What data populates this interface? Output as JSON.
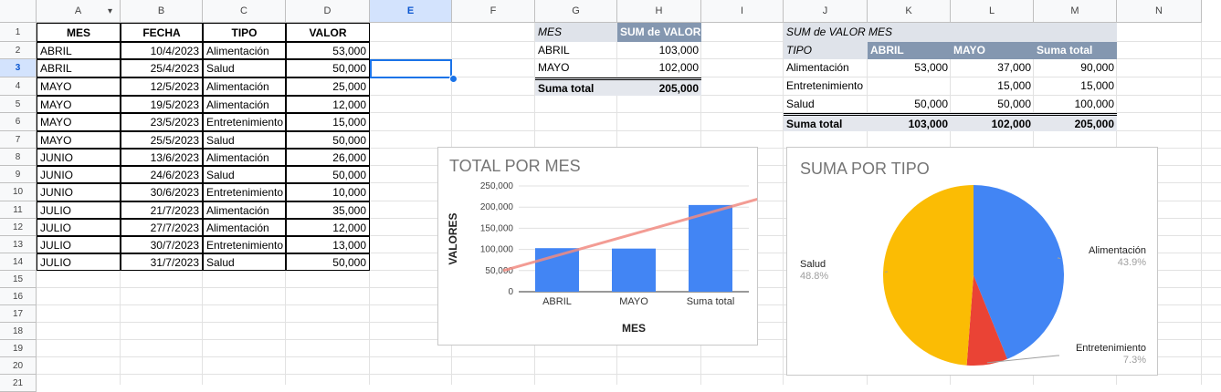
{
  "columns": [
    "A",
    "B",
    "C",
    "D",
    "E",
    "F",
    "G",
    "H",
    "I",
    "J",
    "K",
    "L",
    "M",
    "N"
  ],
  "rows": [
    "1",
    "2",
    "3",
    "4",
    "5",
    "6",
    "7",
    "8",
    "9",
    "10",
    "11",
    "12",
    "13",
    "14",
    "15",
    "16",
    "17",
    "18",
    "19",
    "20",
    "21"
  ],
  "table": {
    "headers": [
      "MES",
      "FECHA",
      "TIPO",
      "VALOR"
    ],
    "rows": [
      [
        "ABRIL",
        "10/4/2023",
        "Alimentación",
        "53,000"
      ],
      [
        "ABRIL",
        "25/4/2023",
        "Salud",
        "50,000"
      ],
      [
        "MAYO",
        "12/5/2023",
        "Alimentación",
        "25,000"
      ],
      [
        "MAYO",
        "19/5/2023",
        "Alimentación",
        "12,000"
      ],
      [
        "MAYO",
        "23/5/2023",
        "Entretenimiento",
        "15,000"
      ],
      [
        "MAYO",
        "25/5/2023",
        "Salud",
        "50,000"
      ],
      [
        "JUNIO",
        "13/6/2023",
        "Alimentación",
        "26,000"
      ],
      [
        "JUNIO",
        "24/6/2023",
        "Salud",
        "50,000"
      ],
      [
        "JUNIO",
        "30/6/2023",
        "Entretenimiento",
        "10,000"
      ],
      [
        "JULIO",
        "21/7/2023",
        "Alimentación",
        "35,000"
      ],
      [
        "JULIO",
        "27/7/2023",
        "Alimentación",
        "12,000"
      ],
      [
        "JULIO",
        "30/7/2023",
        "Entretenimiento",
        "13,000"
      ],
      [
        "JULIO",
        "31/7/2023",
        "Salud",
        "50,000"
      ]
    ]
  },
  "pivot1": {
    "header": [
      "MES",
      "SUM de VALOR"
    ],
    "rows": [
      [
        "ABRIL",
        "103,000"
      ],
      [
        "MAYO",
        "102,000"
      ]
    ],
    "total": [
      "Suma total",
      "205,000"
    ]
  },
  "pivot2": {
    "title": "SUM de VALOR MES",
    "header": [
      "TIPO",
      "ABRIL",
      "MAYO",
      "Suma total"
    ],
    "rows": [
      [
        "Alimentación",
        "53,000",
        "37,000",
        "90,000"
      ],
      [
        "Entretenimiento",
        "",
        "15,000",
        "15,000"
      ],
      [
        "Salud",
        "50,000",
        "50,000",
        "100,000"
      ]
    ],
    "total": [
      "Suma total",
      "103,000",
      "102,000",
      "205,000"
    ]
  },
  "chart_data": [
    {
      "type": "bar",
      "title": "TOTAL POR MES",
      "xlabel": "MES",
      "ylabel": "VALORES",
      "categories": [
        "ABRIL",
        "MAYO",
        "Suma total"
      ],
      "values": [
        103000,
        102000,
        205000
      ],
      "ylim": [
        0,
        250000
      ],
      "yticks": [
        "0",
        "50,000",
        "100,000",
        "150,000",
        "200,000",
        "250,000"
      ],
      "trendline": true,
      "bar_color": "#4285f4",
      "trend_color": "#f28b82",
      "grid": true
    },
    {
      "type": "pie",
      "title": "SUMA POR TIPO",
      "slices": [
        {
          "label": "Alimentación",
          "percent_label": "43.9%",
          "value": 43.9,
          "color": "#4285f4"
        },
        {
          "label": "Entretenimiento",
          "percent_label": "7.3%",
          "value": 7.3,
          "color": "#ea4335"
        },
        {
          "label": "Salud",
          "percent_label": "48.8%",
          "value": 48.8,
          "color": "#fbbc04"
        }
      ]
    }
  ]
}
